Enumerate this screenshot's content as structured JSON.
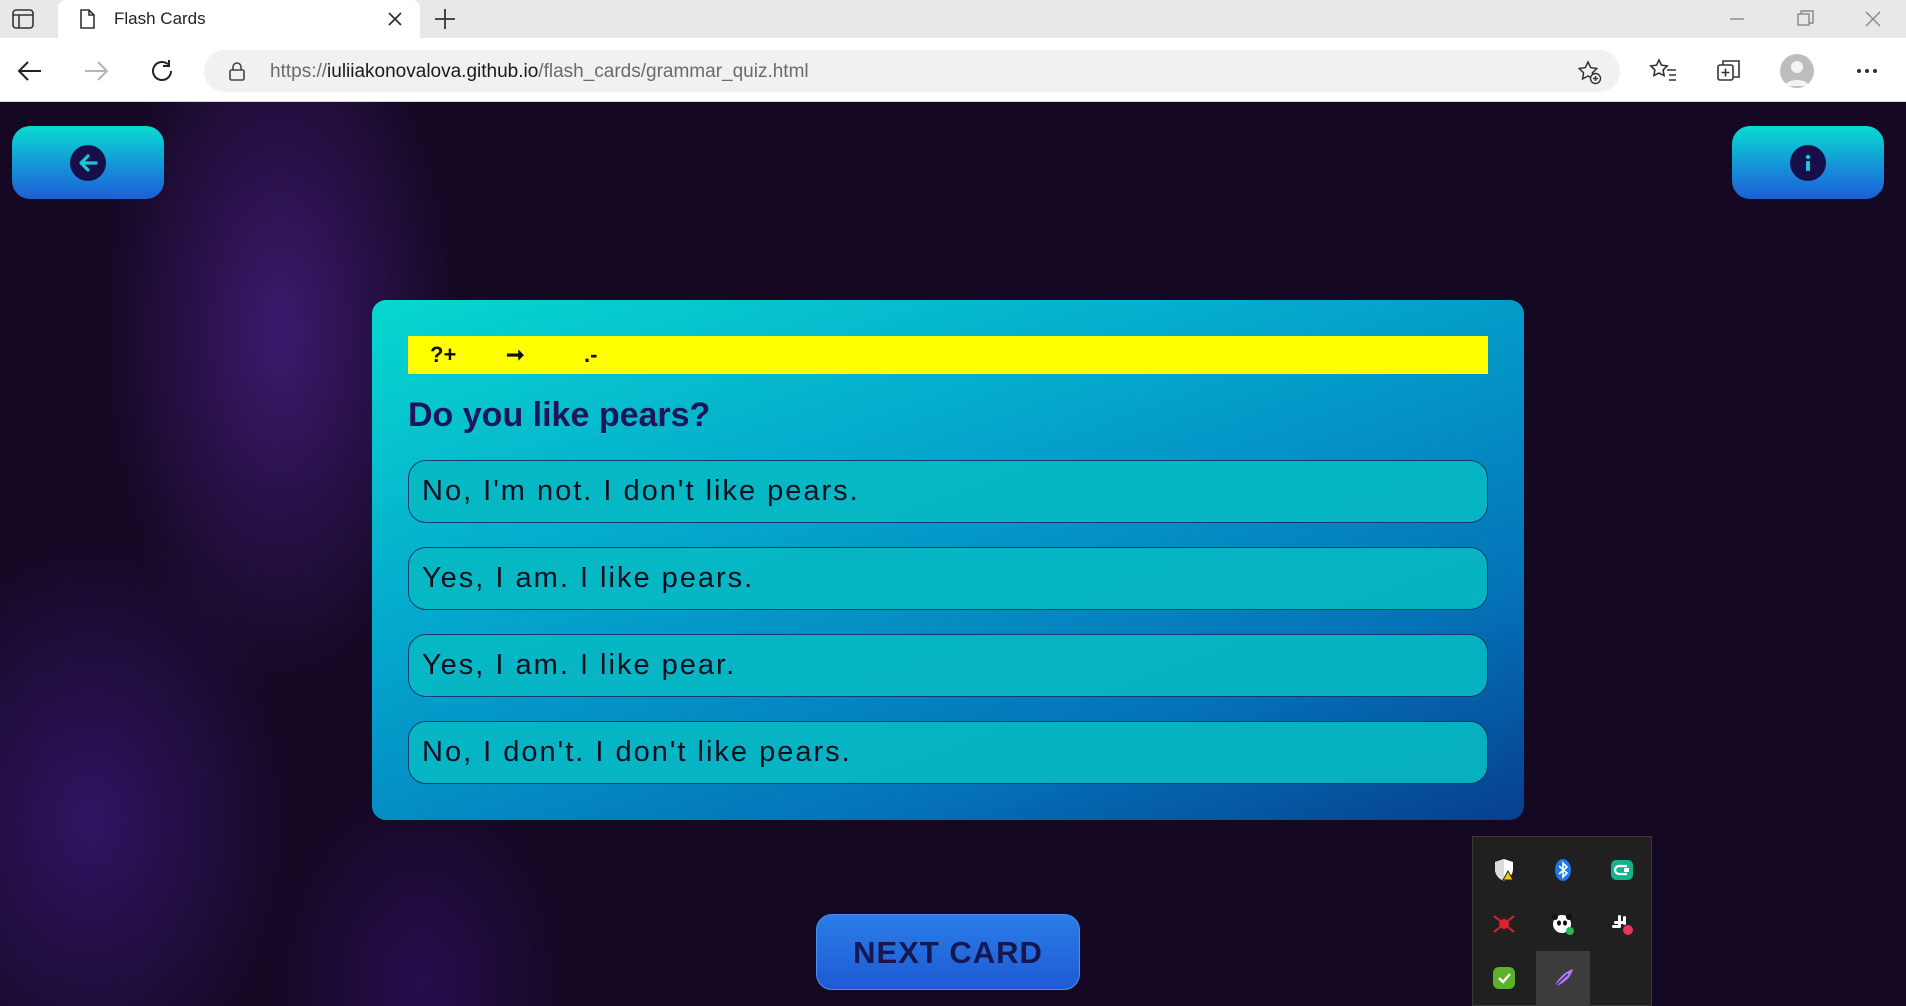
{
  "browser": {
    "tab_title": "Flash Cards",
    "url_prefix": "https://",
    "url_host": "iuliiakonovalova.github.io",
    "url_path": "/flash_cards/grammar_quiz.html"
  },
  "icons": {
    "back": "arrow-left-icon",
    "info": "info-icon"
  },
  "card": {
    "formula": {
      "part1": "?+",
      "arrow": "➞",
      "part2": ".-"
    },
    "question": "Do you like pears?",
    "options": [
      "No, I'm not. I don't like pears.",
      "Yes, I am. I like pears.",
      "Yes, I am. I like pear.",
      "No, I don't. I don't like pears."
    ]
  },
  "next_button_label": "NEXT CARD",
  "colors": {
    "formula_bar": "#ffff00",
    "question_text": "#1d1558",
    "page_background": "#140822",
    "next_button": "#1e5ad4"
  },
  "tray_icons": [
    "windows-security-icon",
    "bluetooth-icon",
    "green-app-icon",
    "red-network-icon",
    "panda-icon",
    "slack-icon",
    "shield-check-icon",
    "feather-pen-icon"
  ]
}
